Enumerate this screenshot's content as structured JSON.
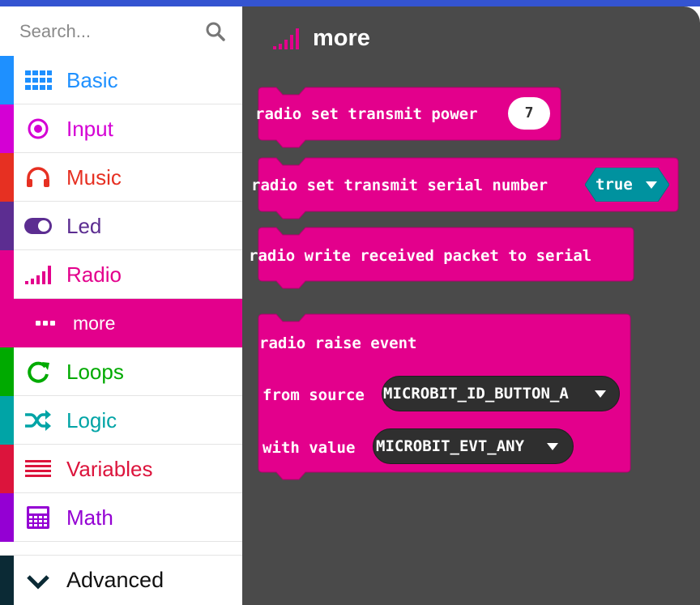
{
  "search": {
    "placeholder": "Search..."
  },
  "categories": [
    {
      "label": "Basic",
      "color": "#1e90ff",
      "icon": "grid-icon"
    },
    {
      "label": "Input",
      "color": "#d400d4",
      "icon": "target-icon"
    },
    {
      "label": "Music",
      "color": "#e63022",
      "icon": "headphones-icon"
    },
    {
      "label": "Led",
      "color": "#5c2d91",
      "icon": "toggle-icon"
    },
    {
      "label": "Radio",
      "color": "#e3008c",
      "icon": "signal-bars-icon"
    },
    {
      "label": "more",
      "color": "#e3008c",
      "icon": "ellipsis-icon"
    },
    {
      "label": "Loops",
      "color": "#00aa00",
      "icon": "refresh-icon"
    },
    {
      "label": "Logic",
      "color": "#00a4a6",
      "icon": "shuffle-icon"
    },
    {
      "label": "Variables",
      "color": "#dc143c",
      "icon": "lines-icon"
    },
    {
      "label": "Math",
      "color": "#9400d3",
      "icon": "calculator-icon"
    }
  ],
  "advanced": {
    "label": "Advanced",
    "color": "#0b2a35"
  },
  "flyout": {
    "title": "more",
    "blocks": {
      "transmit_power": {
        "text": "radio set transmit power",
        "value": "7"
      },
      "serial_number": {
        "text": "radio set transmit serial number",
        "value": "true"
      },
      "write_packet": {
        "text": "radio write received packet to serial"
      },
      "raise_event": {
        "title": "radio raise event",
        "source_label": "from source",
        "source_value": "MICROBIT_ID_BUTTON_A",
        "value_label": "with value",
        "value_value": "MICROBIT_EVT_ANY"
      }
    }
  },
  "colors": {
    "radio": "#e3008c",
    "boolean": "#00929f",
    "flyout_bg": "#4a4a4a",
    "top_bar": "#3454d1"
  }
}
